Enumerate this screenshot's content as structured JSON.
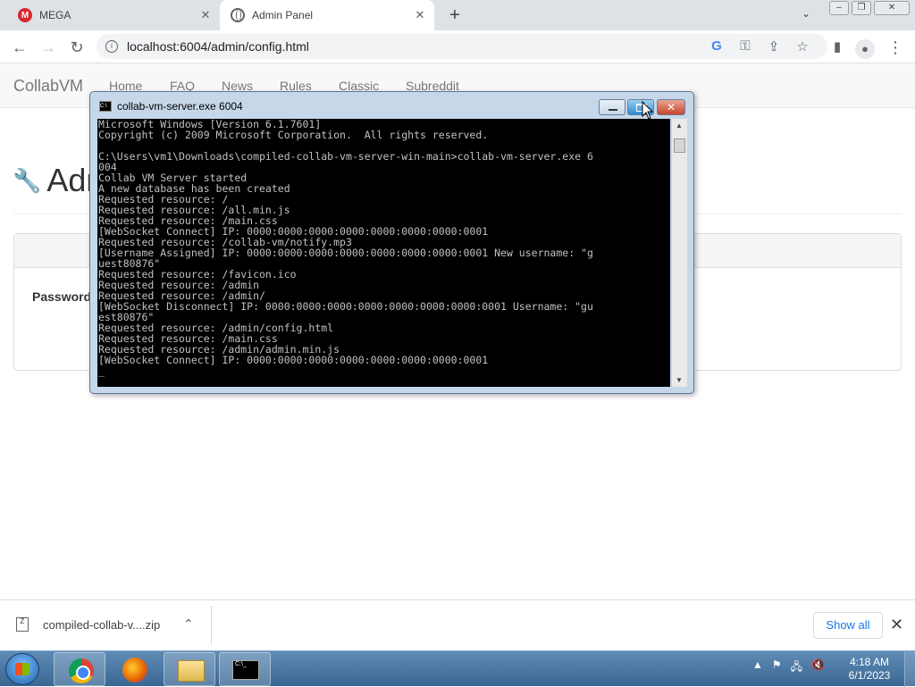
{
  "browser": {
    "tabs": [
      {
        "title": "MEGA",
        "icon": "mega-logo",
        "active": false
      },
      {
        "title": "Admin Panel",
        "icon": "globe-icon",
        "active": true
      }
    ],
    "url": "localhost:6004/admin/config.html"
  },
  "site": {
    "brand": "CollabVM",
    "nav": [
      "Home",
      "FAQ",
      "News",
      "Rules",
      "Classic",
      "Subreddit"
    ],
    "heading": "Adr",
    "password_label": "Password"
  },
  "console": {
    "title": "collab-vm-server.exe  6004",
    "lines": [
      "Microsoft Windows [Version 6.1.7601]",
      "Copyright (c) 2009 Microsoft Corporation.  All rights reserved.",
      "",
      "C:\\Users\\vm1\\Downloads\\compiled-collab-vm-server-win-main>collab-vm-server.exe 6",
      "004",
      "Collab VM Server started",
      "A new database has been created",
      "Requested resource: /",
      "Requested resource: /all.min.js",
      "Requested resource: /main.css",
      "[WebSocket Connect] IP: 0000:0000:0000:0000:0000:0000:0000:0001",
      "Requested resource: /collab-vm/notify.mp3",
      "[Username Assigned] IP: 0000:0000:0000:0000:0000:0000:0000:0001 New username: \"g",
      "uest80876\"",
      "Requested resource: /favicon.ico",
      "Requested resource: /admin",
      "Requested resource: /admin/",
      "[WebSocket Disconnect] IP: 0000:0000:0000:0000:0000:0000:0000:0001 Username: \"gu",
      "est80876\"",
      "Requested resource: /admin/config.html",
      "Requested resource: /main.css",
      "Requested resource: /admin/admin.min.js",
      "[WebSocket Connect] IP: 0000:0000:0000:0000:0000:0000:0000:0001",
      "_"
    ]
  },
  "downloads": {
    "file": "compiled-collab-v....zip",
    "show_all": "Show all"
  },
  "taskbar": {
    "time": "4:18 AM",
    "date": "6/1/2023"
  }
}
